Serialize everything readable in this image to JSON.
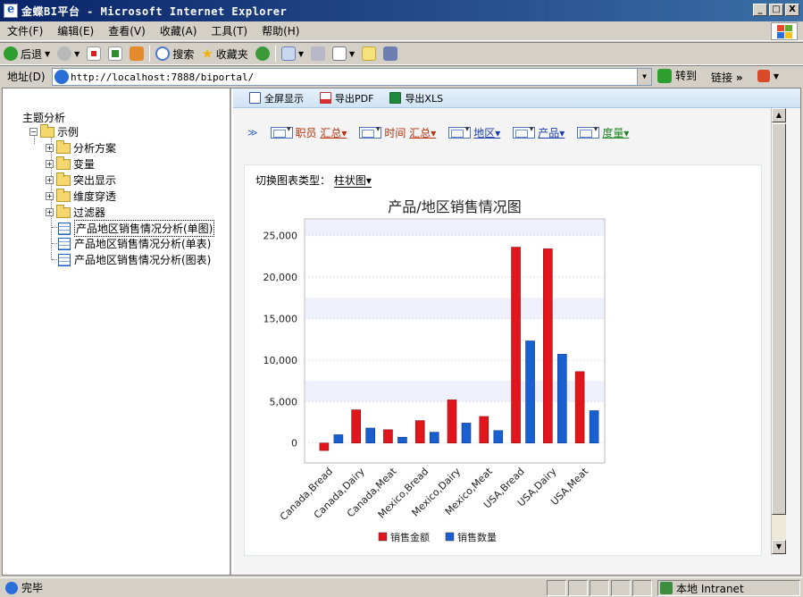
{
  "window": {
    "title": "金蝶BI平台 - Microsoft Internet Explorer",
    "controls": {
      "minimize": "_",
      "maximize": "□",
      "close": "X"
    }
  },
  "menu": [
    "文件(F)",
    "编辑(E)",
    "查看(V)",
    "收藏(A)",
    "工具(T)",
    "帮助(H)"
  ],
  "toolbar": {
    "back": "后退",
    "search": "搜索",
    "favorites": "收藏夹"
  },
  "address": {
    "label": "地址(D)",
    "url": "http://localhost:7888/biportal/",
    "go": "转到",
    "links": "链接"
  },
  "tree": {
    "root": "主题分析",
    "folder": "示例",
    "children": [
      "分析方案",
      "变量",
      "突出显示",
      "维度穿透",
      "过滤器"
    ],
    "reports": [
      "产品地区销售情况分析(单图)",
      "产品地区销售情况分析(单表)",
      "产品地区销售情况分析(图表)"
    ]
  },
  "report_toolbar": {
    "fullscreen": "全屏显示",
    "export_pdf": "导出PDF",
    "export_xls": "导出XLS"
  },
  "dimensions": [
    {
      "name": "职员",
      "agg": "汇总▾",
      "color": "#b5330f"
    },
    {
      "name": "时间",
      "agg": "汇总▾",
      "color": "#b5330f"
    },
    {
      "name": "地区▾",
      "agg": "",
      "color": "#1b3faa"
    },
    {
      "name": "产品▾",
      "agg": "",
      "color": "#1b3faa"
    },
    {
      "name": "度量▾",
      "agg": "",
      "color": "#22882a"
    }
  ],
  "chart_switch": {
    "label": "切换图表类型：",
    "value": "柱状图▾"
  },
  "chart_data": {
    "type": "bar",
    "title": "产品/地区销售情况图",
    "categories": [
      "Canada,Bread",
      "Canada,Dairy",
      "Canada,Meat",
      "Mexico,Bread",
      "Mexico,Dairy",
      "Mexico,Meat",
      "USA,Bread",
      "USA,Dairy",
      "USA,Meat"
    ],
    "series": [
      {
        "name": "销售金额",
        "color": "#e0161c",
        "values": [
          -900,
          4000,
          1600,
          2700,
          5200,
          3200,
          23600,
          23400,
          8600
        ]
      },
      {
        "name": "销售数量",
        "color": "#1a5fd0",
        "values": [
          1000,
          1800,
          700,
          1300,
          2400,
          1500,
          12300,
          10700,
          3900
        ]
      }
    ],
    "yticks": [
      "25,000",
      "20,000",
      "15,000",
      "10,000",
      "5,000",
      "0"
    ],
    "ylim": [
      -2400,
      27000
    ],
    "grid": true,
    "legend": "bottom"
  },
  "status": {
    "text": "完毕",
    "zone": "本地 Intranet"
  }
}
